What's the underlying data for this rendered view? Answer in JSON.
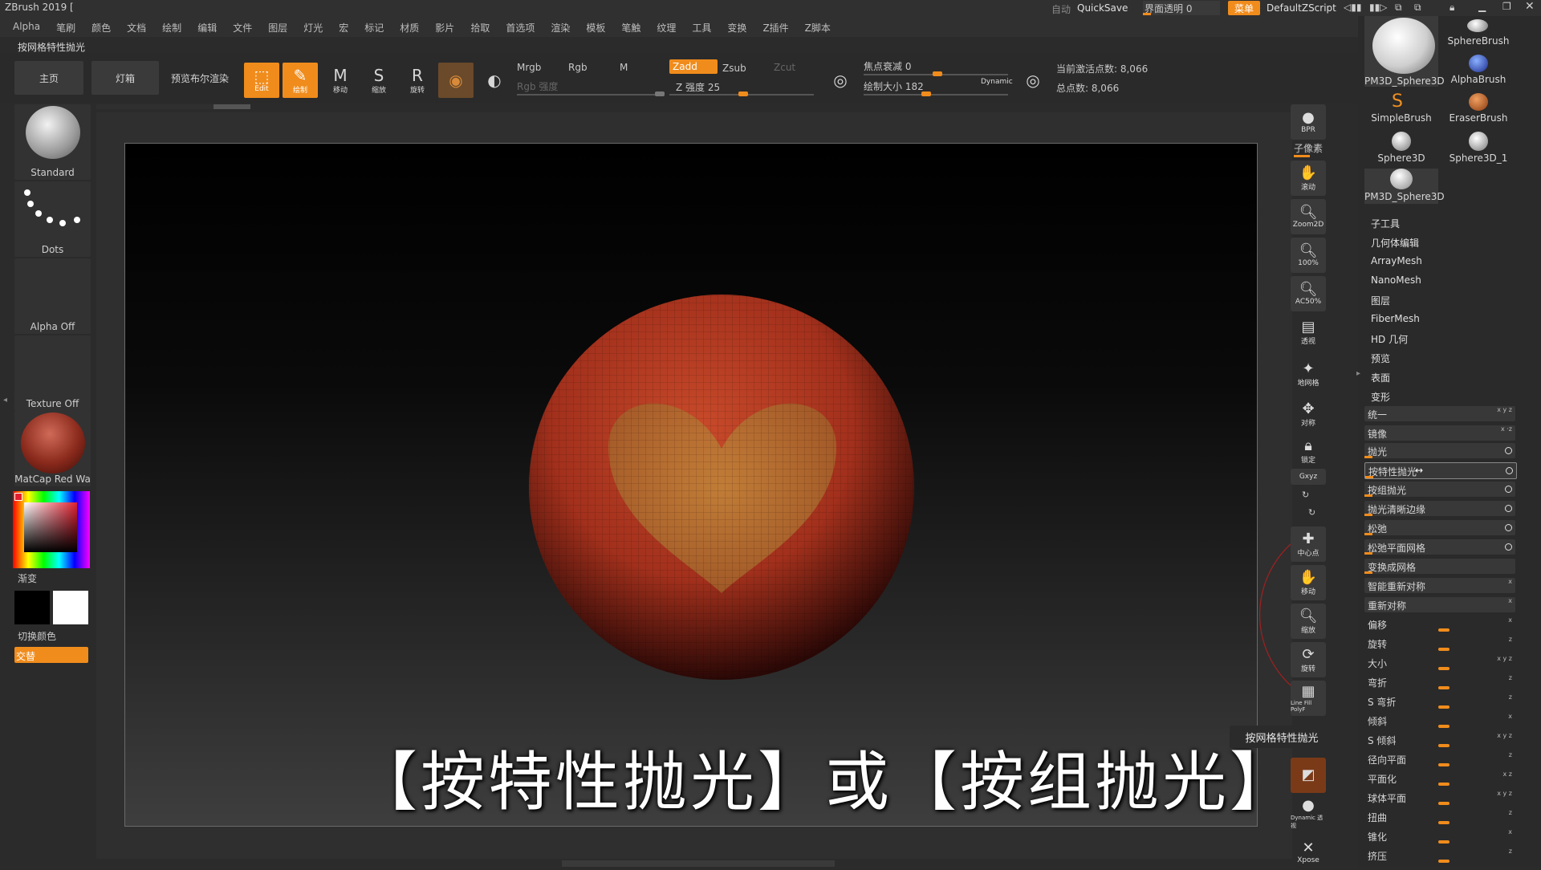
{
  "window": {
    "title": "ZBrush 2019 ["
  },
  "menu": [
    "Alpha",
    "笔刷",
    "颜色",
    "文档",
    "绘制",
    "编辑",
    "文件",
    "图层",
    "灯光",
    "宏",
    "标记",
    "材质",
    "影片",
    "拾取",
    "首选项",
    "渲染",
    "模板",
    "笔触",
    "纹理",
    "工具",
    "变换",
    "Z插件",
    "Z脚本"
  ],
  "topbar": {
    "auto": "自动",
    "quicksave": "QuickSave",
    "ui_transparency": "界面透明 0",
    "menus_button": "菜单",
    "script": "DefaultZScript"
  },
  "info_line": "按网格特性抛光",
  "toolbar": {
    "home": "主页",
    "lightbox": "灯箱",
    "preview_render": "预览布尔渲染",
    "edit": "Edit",
    "draw": "绘制",
    "move": "移动",
    "scale": "缩放",
    "rotate": "旋转",
    "mrgb": "Mrgb",
    "rgb": "Rgb",
    "m": "M",
    "rgb_intensity": "Rgb 强度",
    "zadd": "Zadd",
    "zsub": "Zsub",
    "zcut": "Zcut",
    "z_intensity": "Z 强度 25",
    "focal_shift": "焦点衰减 0",
    "draw_size": "绘制大小 182",
    "dynamic": "Dynamic",
    "active_points": "当前激活点数: 8,066",
    "total_points": "总点数: 8,066"
  },
  "shelf": {
    "brush": "Standard",
    "stroke": "Dots",
    "alpha": "Alpha Off",
    "texture": "Texture Off",
    "material": "MatCap Red Wa",
    "gradient": "渐变",
    "switch_color": "切换颜色",
    "alternate": "交替"
  },
  "subtitle": "【按特性抛光】或【按组抛光】",
  "right_icons": [
    "BPR",
    "子像素",
    "滚动",
    "Zoom2D",
    "100%",
    "AC50%",
    "透视",
    "地网格",
    "对称",
    "锁定",
    "Gxyz",
    "中心点",
    "移动",
    "缩放",
    "旋转",
    "Line Fill PolyF",
    "Dynamic 透视",
    "Xpose"
  ],
  "brushes": [
    "PM3D_Sphere3D",
    "SphereBrush",
    "AlphaBrush",
    "SimpleBrush",
    "EraserBrush",
    "Sphere3D",
    "Sphere3D_1",
    "PM3D_Sphere3D"
  ],
  "tool_menu": [
    "子工具",
    "几何体编辑",
    "ArrayMesh",
    "NanoMesh",
    "图层",
    "FiberMesh",
    "HD 几何",
    "预览",
    "表面",
    "变形"
  ],
  "deformation": [
    "统一",
    "镜像",
    "抛光",
    "按特性抛光",
    "按组抛光",
    "抛光清晰边缘",
    "松弛",
    "松弛平面网格",
    "变换成网格",
    "智能重新对称",
    "重新对称",
    "偏移",
    "旋转",
    "大小",
    "弯折",
    "S 弯折",
    "倾斜",
    "S 倾斜",
    "径向平面",
    "平面化",
    "球体平面",
    "扭曲",
    "锥化",
    "挤压"
  ],
  "tooltip": "按网格特性抛光",
  "colors": {
    "accent": "#f08c1c",
    "sphere": "#b83a22",
    "heart": "#b8923a"
  }
}
